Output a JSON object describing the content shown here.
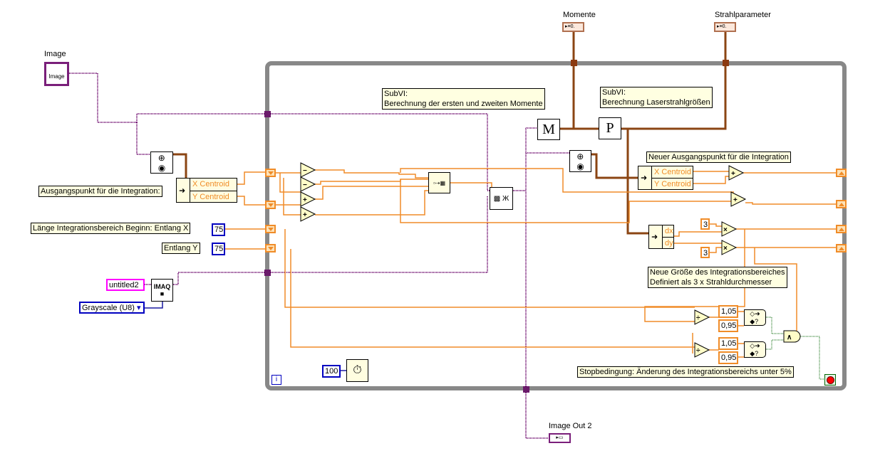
{
  "diagram": {
    "controls": {
      "image": {
        "label": "Image",
        "inner": "Image"
      },
      "image_out": {
        "label": "Image Out 2"
      },
      "momente": {
        "label": "Momente"
      },
      "strahlparameter": {
        "label": "Strahlparameter"
      }
    },
    "comments": {
      "start": "Ausgangspunkt für die Integration:",
      "length_x": "Länge Integrationsbereich Beginn: Entlang X",
      "length_y": "Entlang Y",
      "subvi_m_1": "SubVI:",
      "subvi_m_2": "Berechnung der ersten und zweiten Momente",
      "subvi_p_1": "SubVI:",
      "subvi_p_2": "Berechnung Laserstrahlgrößen",
      "new_start": "Neuer Ausgangspunkt für die Integration",
      "new_size_1": "Neue Größe des Integrationsbereiches",
      "new_size_2": "Definiert als 3 x Strahldurchmesser",
      "stop": "Stopbedingung: Änderung des Integrationsbereichs unter 5%"
    },
    "unbundle1": [
      "X Centroid",
      "Y Centroid"
    ],
    "unbundle2": [
      "X Centroid",
      "Y Centroid"
    ],
    "unbundle3": [
      "dx",
      "dy"
    ],
    "constants": {
      "len_x": "75",
      "len_y": "75",
      "image_name": "untitled2",
      "image_type": "Grayscale (U8)",
      "imaq": "IMAQ",
      "factor1": "3",
      "factor2": "3",
      "upper1": "1,05",
      "lower1": "0,95",
      "upper2": "1,05",
      "lower2": "0,95",
      "wait_ms": "100",
      "iteration": "i"
    },
    "subvis": {
      "m": "M",
      "p": "P"
    },
    "operators": {
      "sub": "−",
      "add": "+",
      "mul": "×",
      "div": "÷",
      "and": "∧"
    },
    "colors": {
      "numeric_wire": "#f08c28",
      "image_wire": "#7a1f7a",
      "cluster_wire": "#8b4513",
      "boolean_wire": "#006400",
      "int_const": "#0000c0",
      "loop_frame": "#808080"
    }
  }
}
